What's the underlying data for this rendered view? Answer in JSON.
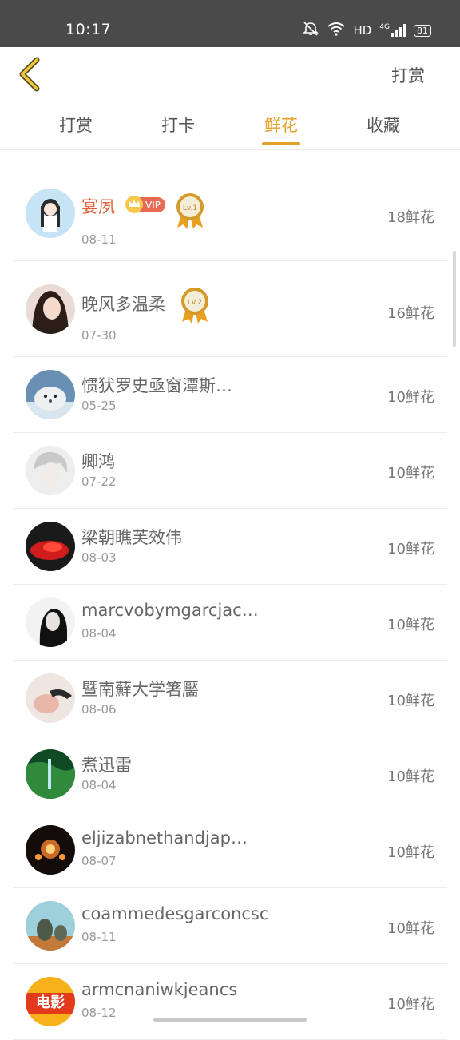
{
  "status_bar": {
    "time": "10:17",
    "network": "HD",
    "signal": "4G",
    "battery": "81"
  },
  "header": {
    "action": "打赏"
  },
  "tabs": [
    {
      "label": "打赏",
      "active": false
    },
    {
      "label": "打卡",
      "active": false
    },
    {
      "label": "鲜花",
      "active": true
    },
    {
      "label": "收藏",
      "active": false
    }
  ],
  "vip_label": "VIP",
  "list": [
    {
      "name": "宴夙",
      "date": "08-11",
      "count": "18鲜花",
      "vip": true,
      "medal": "Lv.1"
    },
    {
      "name": "晚风多温柔",
      "date": "07-30",
      "count": "16鲜花",
      "medal": "Lv.2"
    },
    {
      "name": "惯犾罗史亟窗潭斯…",
      "date": "05-25",
      "count": "10鲜花"
    },
    {
      "name": "卿鸿",
      "date": "07-22",
      "count": "10鲜花"
    },
    {
      "name": "梁朝瞧芙效伟",
      "date": "08-03",
      "count": "10鲜花"
    },
    {
      "name": "marcvobymgarcjac…",
      "date": "08-04",
      "count": "10鲜花"
    },
    {
      "name": "暨南蘚大学箸靨",
      "date": "08-06",
      "count": "10鲜花"
    },
    {
      "name": "煮迅雷",
      "date": "08-04",
      "count": "10鲜花"
    },
    {
      "name": "eljizabnethandjap…",
      "date": "08-07",
      "count": "10鲜花"
    },
    {
      "name": "coammedesgarconcsc",
      "date": "08-11",
      "count": "10鲜花"
    },
    {
      "name": "armcnaniwkjeancs",
      "date": "08-12",
      "count": "10鲜花",
      "avatar_text": "电影"
    }
  ],
  "colors": {
    "accent": "#e5a028",
    "vip_name": "#e0623a",
    "vip_badge": "#e86a52",
    "status_bar": "#4a4a4a"
  }
}
